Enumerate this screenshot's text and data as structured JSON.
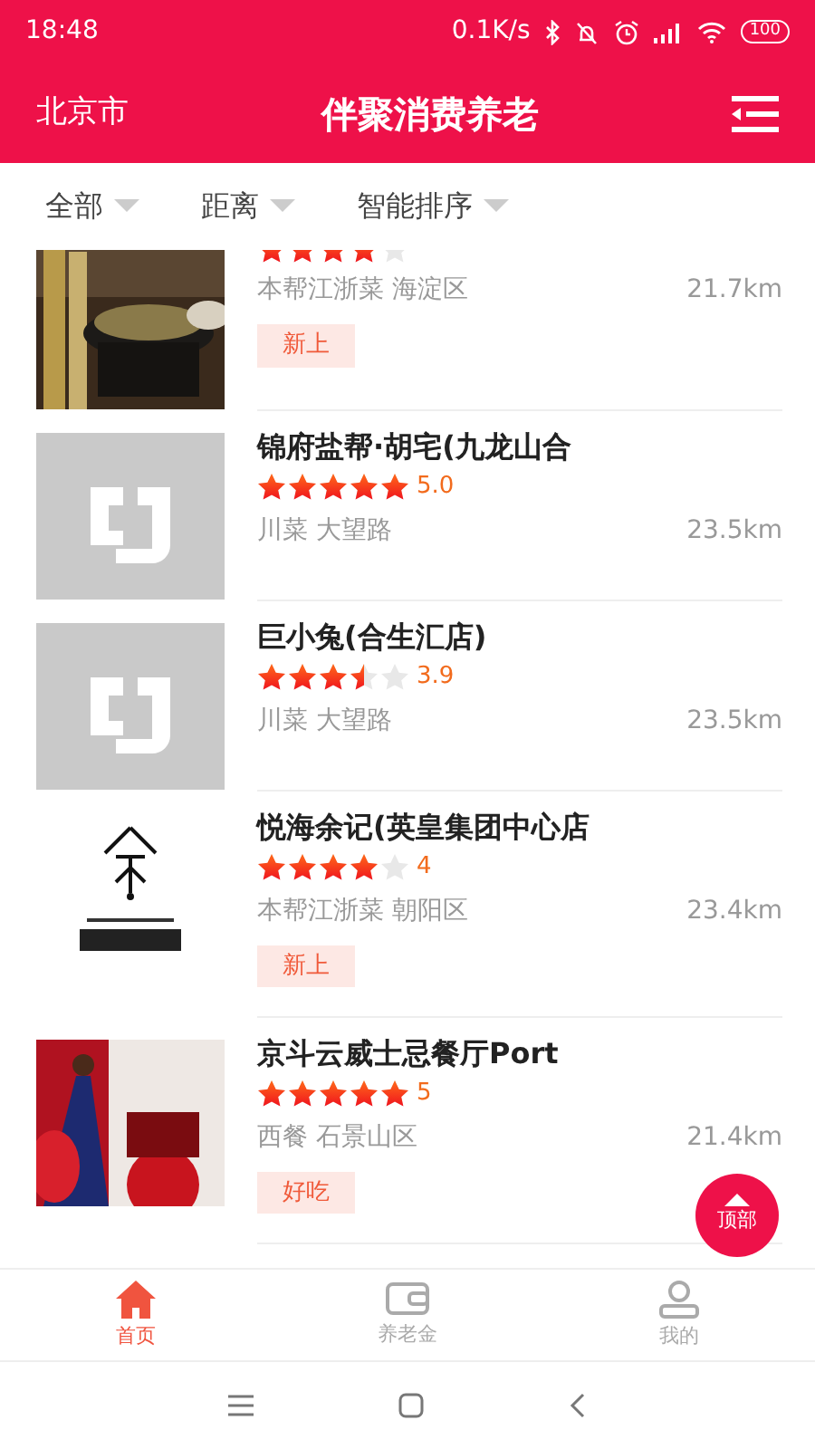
{
  "status_bar": {
    "time": "18:48",
    "speed": "0.1K/s",
    "battery": "100"
  },
  "header": {
    "city": "北京市",
    "title": "伴聚消费养老"
  },
  "filters": [
    {
      "label": "全部"
    },
    {
      "label": "距离"
    },
    {
      "label": "智能排序"
    }
  ],
  "restaurants": [
    {
      "stars": 4,
      "cuisine": "本帮江浙菜 海淀区",
      "distance": "21.7km",
      "tag": "新上"
    },
    {
      "kind": "placeholder",
      "name": "锦府盐帮·胡宅(九龙山合",
      "stars": 5,
      "rating": "5.0",
      "cuisine": "川菜 大望路",
      "distance": "23.5km"
    },
    {
      "kind": "placeholder",
      "name": "巨小兔(合生汇店)",
      "stars": 3.5,
      "rating": "3.9",
      "cuisine": "川菜 大望路",
      "distance": "23.5km"
    },
    {
      "kind": "logo",
      "name": "悦海余记(英皇集团中心店",
      "stars": 4,
      "rating": "4",
      "cuisine": "本帮江浙菜 朝阳区",
      "distance": "23.4km",
      "tag": "新上"
    },
    {
      "kind": "poster",
      "name": "京斗云威士忌餐厅Port",
      "stars": 5,
      "rating": "5",
      "cuisine": "西餐 石景山区",
      "distance": "21.4km",
      "tag": "好吃"
    }
  ],
  "back_to_top": "顶部",
  "tab_bar": [
    {
      "label": "首页",
      "selected": true
    },
    {
      "label": "养老金",
      "selected": false
    },
    {
      "label": "我的",
      "selected": false
    }
  ]
}
